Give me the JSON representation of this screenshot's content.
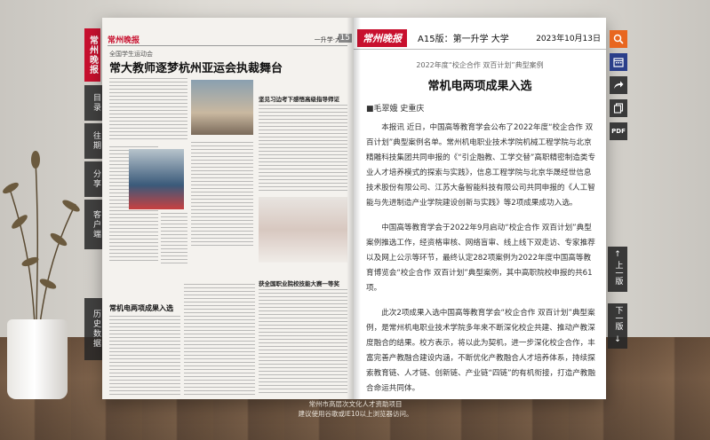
{
  "left_page": {
    "brand": "常州晚报",
    "masthead_logo": "常州晚报",
    "section": "一升学·大学",
    "page_number": "15",
    "kicker": "全国学生运动会",
    "headline": "常大教师逐梦杭州亚运会执裁舞台",
    "sub_headline_1": "坚见习边考下感悟高级指导师证",
    "sub_headline_2": "获全国职业院校技能大赛一等奖",
    "box_title": "常机电两项成果入选"
  },
  "side_nav": {
    "items": [
      {
        "label": "目录"
      },
      {
        "label": "往期"
      },
      {
        "label": "分享"
      },
      {
        "label": "客户端"
      },
      {
        "label": "历史数据"
      }
    ]
  },
  "right_page": {
    "logo": "常州晚报",
    "page_label": "A15版：第一升学 大学",
    "date": "2023年10月13日",
    "kicker": "2022年度“校企合作 双百计划”典型案例",
    "title": "常机电两项成果入选",
    "author": "■毛翠娥 史重庆",
    "paragraphs": [
      "本报讯 近日，中国高等教育学会公布了2022年度“校企合作 双百计划”典型案例名单。常州机电职业技术学院机械工程学院与北京精雕科技集团共同申报的《“引企融教、工学交替”高职精密制造类专业人才培养模式的探索与实践》，信息工程学院与北京华晟经世信息技术股份有限公司、江苏大备智能科技有限公司共同申报的《人工智能与先进制造产业学院建设创新与实践》等2项成果成功入选。",
      "中国高等教育学会于2022年9月启动“校企合作 双百计划”典型案例推选工作，经资格审核、网络盲审、线上线下双走访、专家推荐以及网上公示等环节，最终认定282项案例为2022年度中国高等教育博览会“校企合作 双百计划”典型案例，其中高职院校申报的共61项。",
      "此次2项成果入选中国高等教育学会“校企合作 双百计划”典型案例，是常州机电职业技术学院多年来不断深化校企共建、推动产教深度融合的结果。校方表示，将以此为契机，进一步深化校企合作，丰富完善产教融合建设内涵，不断优化产教融合人才培养体系，持续探索教育链、人才链、创新链、产业链“四链”的有机衔接，打造产教融合命运共同体。"
    ]
  },
  "toolbar": {
    "pdf_label": "PDF",
    "prev_label": "上一版",
    "next_label": "下一版"
  },
  "footer": {
    "line1": "常州市高层次文化人才资助项目",
    "line2": "建议使用谷歌或IE10以上浏览器访问。"
  }
}
